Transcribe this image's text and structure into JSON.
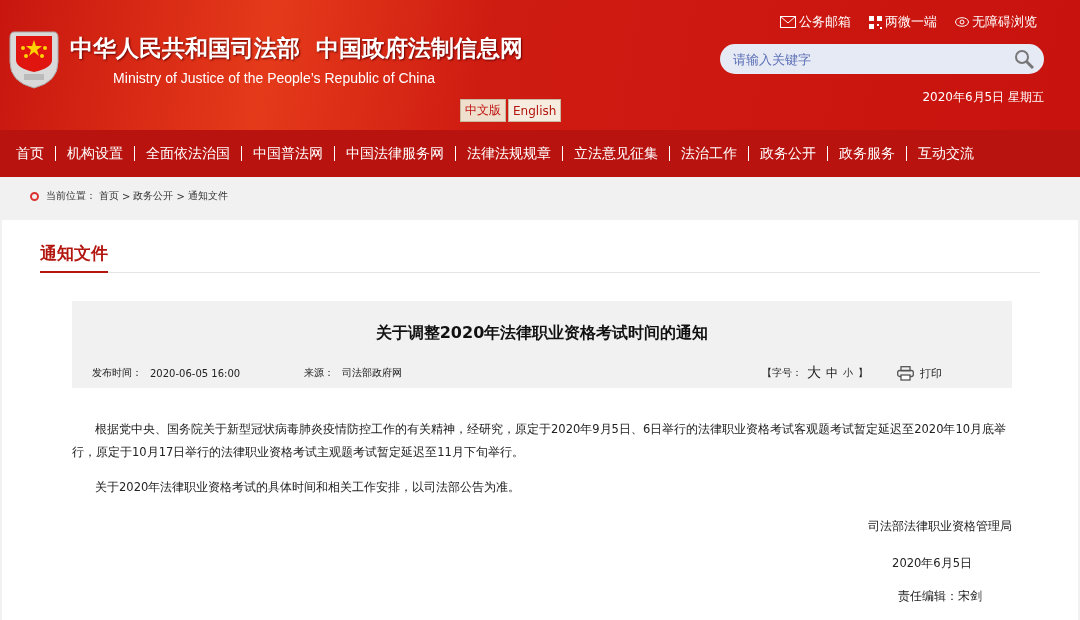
{
  "header": {
    "title": "中华人民共和国司法部  中国政府法制信息网",
    "subtitle": "Ministry of Justice of the People’s Republic of China",
    "languages": [
      {
        "label": "中文版",
        "selected": true
      },
      {
        "label": "English",
        "selected": false
      }
    ],
    "top_links": [
      {
        "label": "公务邮箱",
        "kind": "mail"
      },
      {
        "label": "两微一端",
        "kind": "qr"
      },
      {
        "label": "无障碍浏览",
        "kind": "eye"
      }
    ],
    "search": {
      "placeholder": "请输入关键字"
    },
    "date": "2020年6月5日 星期五"
  },
  "nav": {
    "items": [
      {
        "label": "首页"
      },
      {
        "label": "机构设置"
      },
      {
        "label": "全面依法治国"
      },
      {
        "label": "中国普法网"
      },
      {
        "label": "中国法律服务网"
      },
      {
        "label": "法律法规规章"
      },
      {
        "label": "立法意见征集"
      },
      {
        "label": "法治工作"
      },
      {
        "label": "政务公开"
      },
      {
        "label": "政务服务"
      },
      {
        "label": "互动交流"
      }
    ]
  },
  "breadcrumb": {
    "label": "当前位置：",
    "items": [
      "首页",
      "政务公开",
      "通知文件"
    ],
    "separator": ">"
  },
  "section": {
    "title": "通知文件"
  },
  "article": {
    "title": "关于调整2020年法律职业资格考试时间的通知",
    "published_label": "发布时间：",
    "published": "2020-06-05 16:00",
    "source_label": "来源：",
    "source": "司法部政府网",
    "font_size_open": "【字号：",
    "font_sizes": [
      "大",
      "中",
      "小"
    ],
    "font_size_close": "】",
    "print": "打印",
    "paragraphs": [
      "根据党中央、国务院关于新型冠状病毒肺炎疫情防控工作的有关精神，经研究，原定于2020年9月5日、6日举行的法律职业资格考试客观题考试暂定延迟至2020年10月底举行，原定于10月17日举行的法律职业资格考试主观题考试暂定延迟至11月下旬举行。",
      "关于2020年法律职业资格考试的具体时间和相关工作安排，以司法部公告为准。"
    ],
    "signature": "司法部法律职业资格管理局",
    "date": "2020年6月5日",
    "editor": "责任编辑：宋剑"
  }
}
